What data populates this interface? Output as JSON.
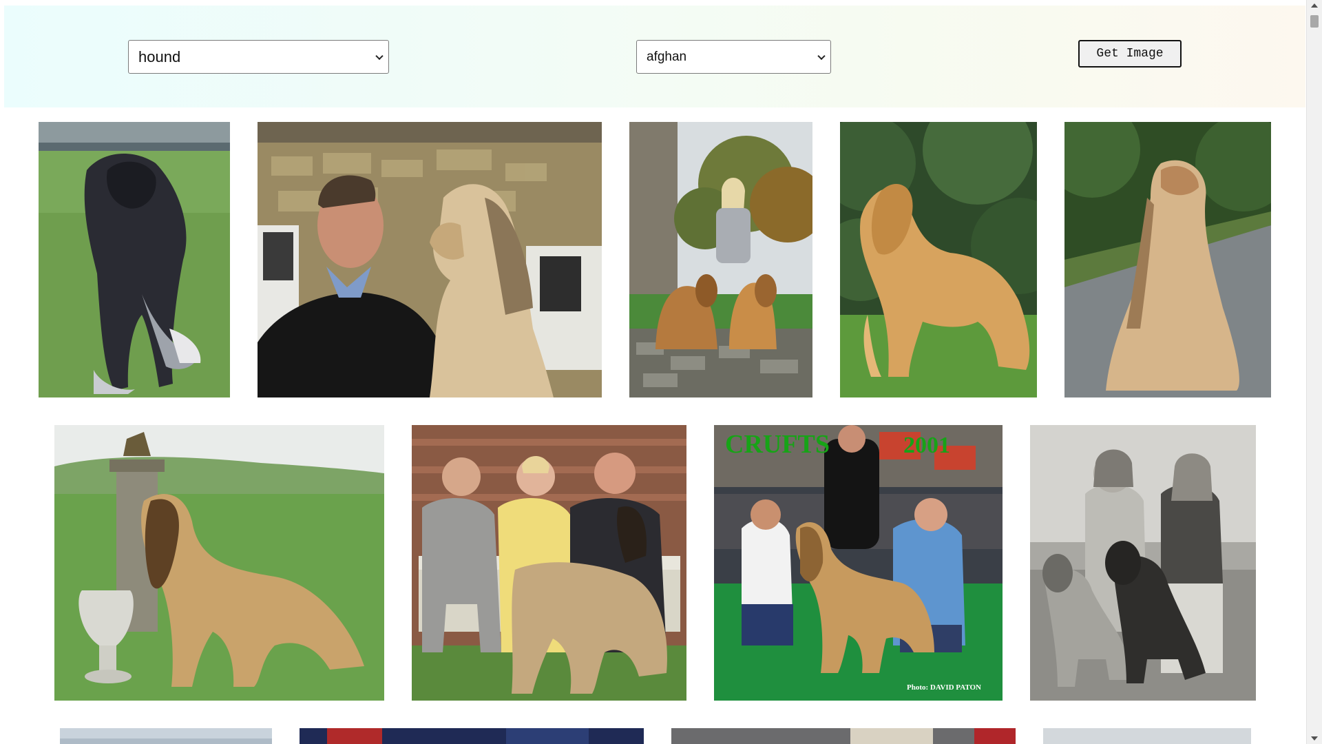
{
  "controls": {
    "breed_select_value": "hound",
    "sub_breed_select_value": "afghan",
    "get_image_label": "Get Image"
  },
  "gallery": {
    "rows": [
      [
        {
          "subject": "black and silver afghan hound standing on grass"
        },
        {
          "subject": "man in dark sweater beside blonde afghan hound"
        },
        {
          "subject": "woman seated on stone wall with two afghan hounds"
        },
        {
          "subject": "golden afghan hound standing before evergreen"
        },
        {
          "subject": "cream afghan hound sitting on road"
        }
      ],
      [
        {
          "subject": "golden afghan hound beside trophy and pedestal in field"
        },
        {
          "subject": "three people on bench with afghan hound"
        },
        {
          "subject": "show ring group photo with afghan hound",
          "overlay_title": "CRUFTS",
          "overlay_year": "2001",
          "credit": "Photo: DAVID PATON"
        },
        {
          "subject": "black and white photo of two women with two afghan hounds"
        }
      ],
      [
        {
          "subject": "partially visible image"
        },
        {
          "subject": "partially visible image"
        },
        {
          "subject": "partially visible image"
        },
        {
          "subject": "partially visible image"
        }
      ]
    ]
  },
  "colors": {
    "crufts_text": "#17a317",
    "show_carpet": "#1f8f3e"
  }
}
